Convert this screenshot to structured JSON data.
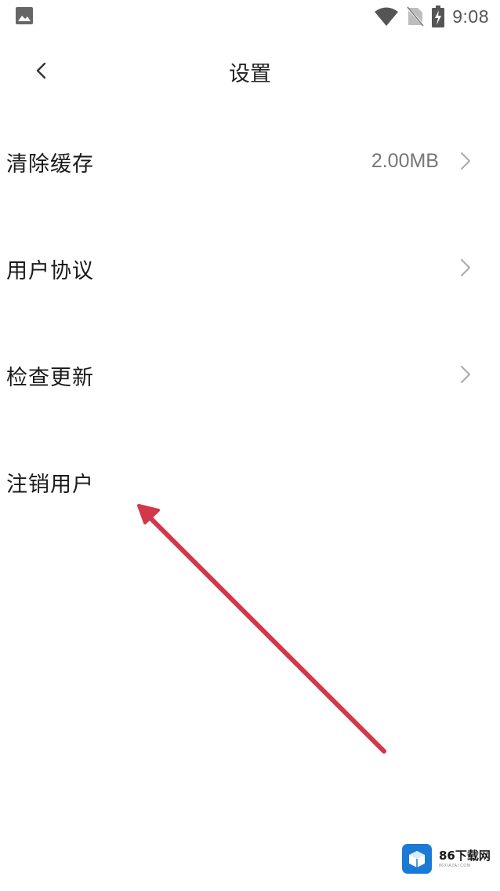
{
  "status_bar": {
    "time": "9:08",
    "left_icon": "image-icon",
    "icons": [
      "wifi-icon",
      "no-sim-icon",
      "battery-charging-icon"
    ]
  },
  "header": {
    "title": "设置",
    "back_icon": "chevron-left-icon"
  },
  "settings": {
    "items": [
      {
        "label": "清除缓存",
        "value": "2.00MB",
        "has_chevron": true
      },
      {
        "label": "用户协议",
        "value": "",
        "has_chevron": true
      },
      {
        "label": "检查更新",
        "value": "",
        "has_chevron": true
      },
      {
        "label": "注销用户",
        "value": "",
        "has_chevron": false
      }
    ]
  },
  "annotation": {
    "arrow_color": "#d2374a"
  },
  "watermark": {
    "text": "86下载网",
    "subtext": "86XIAZAI.COM",
    "color": "#1a7ad6"
  }
}
